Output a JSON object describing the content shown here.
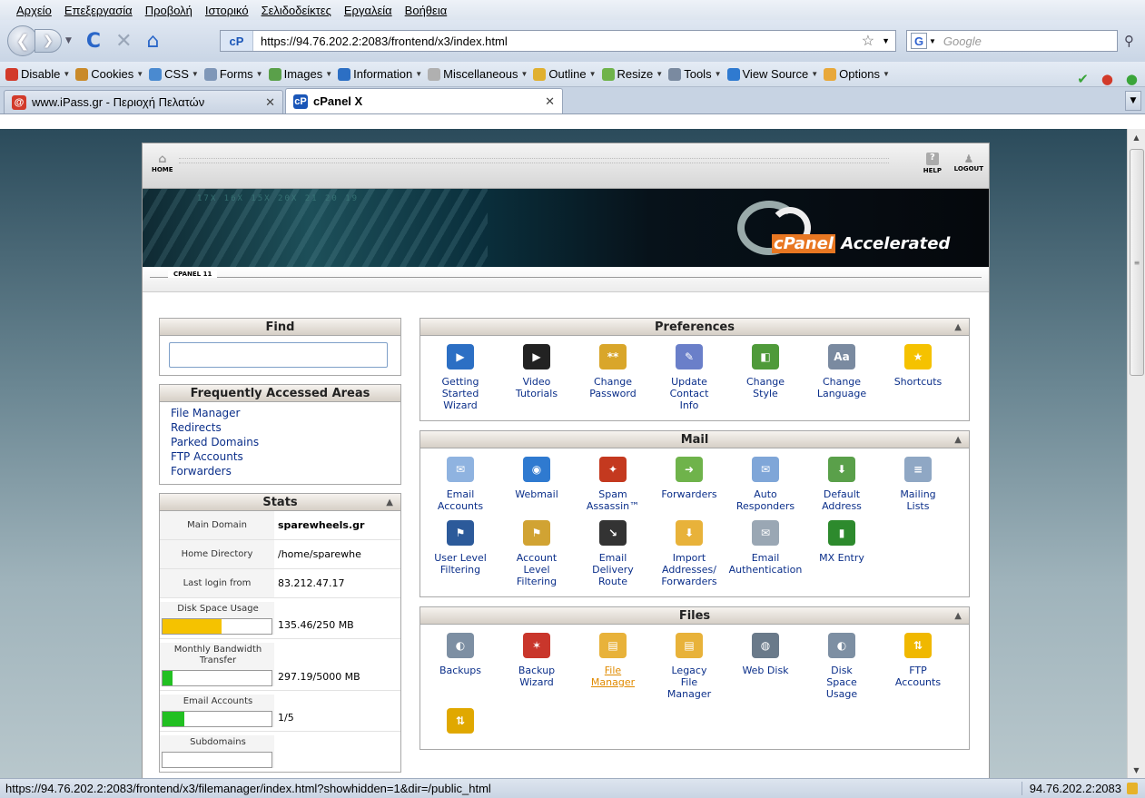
{
  "menubar": {
    "items": [
      "Αρχείο",
      "Επεξεργασία",
      "Προβολή",
      "Ιστορικό",
      "Σελιδοδείκτες",
      "Εργαλεία",
      "Βοήθεια"
    ]
  },
  "navbar": {
    "url": "https://94.76.202.2:2083/frontend/x3/index.html",
    "search_placeholder": "Google"
  },
  "toolbar": {
    "items": [
      "Disable",
      "Cookies",
      "CSS",
      "Forms",
      "Images",
      "Information",
      "Miscellaneous",
      "Outline",
      "Resize",
      "Tools",
      "View Source",
      "Options"
    ]
  },
  "tabs": [
    {
      "label": "www.iPass.gr - Περιοχή Πελατών",
      "active": false
    },
    {
      "label": "cPanel X",
      "active": true
    }
  ],
  "cpanel": {
    "home_label": "HOME",
    "help_label": "HELP",
    "logout_label": "LOGOUT",
    "banner_brand_a": "cPanel",
    "banner_brand_b": "Accelerated",
    "banner_digits": "17X  16X  15X  20X  21  20  19",
    "version_label": "CPANEL 11"
  },
  "sidebar": {
    "find_title": "Find",
    "faa_title": "Frequently Accessed Areas",
    "faa_links": [
      "File Manager",
      "Redirects",
      "Parked Domains",
      "FTP Accounts",
      "Forwarders"
    ],
    "stats_title": "Stats",
    "stats": [
      {
        "label": "Main Domain",
        "value": "sparewheels.gr"
      },
      {
        "label": "Home Directory",
        "value": "/home/sparewhe"
      },
      {
        "label": "Last login from",
        "value": "83.212.47.17"
      }
    ],
    "bars": [
      {
        "label": "Disk Space Usage",
        "value": "135.46/250 MB",
        "fraction": 0.54,
        "color": "#f5c200"
      },
      {
        "label": "Monthly Bandwidth Transfer",
        "value": "297.19/5000 MB",
        "fraction": 0.09,
        "color": "#22c022"
      },
      {
        "label": "Email Accounts",
        "value": "1/5",
        "fraction": 0.2,
        "color": "#22c022"
      },
      {
        "label": "Subdomains",
        "value": "",
        "fraction": 0,
        "color": "#22c022"
      }
    ]
  },
  "panels": [
    {
      "title": "Preferences",
      "items": [
        {
          "label": "Getting\nStarted\nWizard",
          "icon": "play-icon",
          "color": "#2c6fc4",
          "glyph": "▶"
        },
        {
          "label": "Video\nTutorials",
          "icon": "video-icon",
          "color": "#222",
          "glyph": "▶"
        },
        {
          "label": "Change\nPassword",
          "icon": "password-icon",
          "color": "#d9a62a",
          "glyph": "**"
        },
        {
          "label": "Update\nContact\nInfo",
          "icon": "contact-icon",
          "color": "#6a7fc9",
          "glyph": "✎"
        },
        {
          "label": "Change\nStyle",
          "icon": "style-icon",
          "color": "#4f9a3a",
          "glyph": "◧"
        },
        {
          "label": "Change\nLanguage",
          "icon": "language-icon",
          "color": "#7a8aa0",
          "glyph": "Aa"
        },
        {
          "label": "Shortcuts",
          "icon": "star-icon",
          "color": "#f5c200",
          "glyph": "★"
        }
      ]
    },
    {
      "title": "Mail",
      "items": [
        {
          "label": "Email\nAccounts",
          "icon": "envelope-icon",
          "color": "#8fb3e0",
          "glyph": "✉"
        },
        {
          "label": "Webmail",
          "icon": "globe-icon",
          "color": "#2f7ad0",
          "glyph": "◉"
        },
        {
          "label": "Spam\nAssassin™",
          "icon": "spam-icon",
          "color": "#c4391f",
          "glyph": "✦"
        },
        {
          "label": "Forwarders",
          "icon": "forward-icon",
          "color": "#6fb34b",
          "glyph": "➜"
        },
        {
          "label": "Auto\nResponders",
          "icon": "autorespond-icon",
          "color": "#7fa6d8",
          "glyph": "✉"
        },
        {
          "label": "Default\nAddress",
          "icon": "default-address-icon",
          "color": "#5aa04a",
          "glyph": "⬇"
        },
        {
          "label": "Mailing\nLists",
          "icon": "mailing-list-icon",
          "color": "#8fa7c4",
          "glyph": "≡"
        },
        {
          "label": "User Level\nFiltering",
          "icon": "user-filter-icon",
          "color": "#2c5a9a",
          "glyph": "⚑"
        },
        {
          "label": "Account\nLevel\nFiltering",
          "icon": "account-filter-icon",
          "color": "#d1a333",
          "glyph": "⚑"
        },
        {
          "label": "Email\nDelivery\nRoute",
          "icon": "delivery-icon",
          "color": "#333",
          "glyph": "↘"
        },
        {
          "label": "Import\nAddresses/\nForwarders",
          "icon": "import-icon",
          "color": "#e8b23a",
          "glyph": "⬇"
        },
        {
          "label": "Email\nAuthentication",
          "icon": "authentication-icon",
          "color": "#9aa7b4",
          "glyph": "✉"
        },
        {
          "label": "MX Entry",
          "icon": "mx-icon",
          "color": "#2d8a2d",
          "glyph": "▮"
        }
      ]
    },
    {
      "title": "Files",
      "items": [
        {
          "label": "Backups",
          "icon": "backup-icon",
          "color": "#7d8fa3",
          "glyph": "◐"
        },
        {
          "label": "Backup\nWizard",
          "icon": "backup-wizard-icon",
          "color": "#c9362b",
          "glyph": "✶"
        },
        {
          "label": "File\nManager",
          "icon": "folder-icon",
          "color": "#e8b23a",
          "glyph": "▤",
          "highlight": true
        },
        {
          "label": "Legacy\nFile\nManager",
          "icon": "legacy-folder-icon",
          "color": "#e8b23a",
          "glyph": "▤"
        },
        {
          "label": "Web Disk",
          "icon": "web-disk-icon",
          "color": "#6a7a8a",
          "glyph": "◍"
        },
        {
          "label": "Disk\nSpace\nUsage",
          "icon": "disk-icon",
          "color": "#7d8fa3",
          "glyph": "◐"
        },
        {
          "label": "FTP\nAccounts",
          "icon": "ftp-icon",
          "color": "#f0b800",
          "glyph": "⇅"
        },
        {
          "label": "",
          "icon": "ftp-session-icon",
          "color": "#e0a800",
          "glyph": "⇅"
        }
      ]
    }
  ],
  "statusbar": {
    "url": "https://94.76.202.2:2083/frontend/x3/filemanager/index.html?showhidden=1&dir=/public_html",
    "host": "94.76.202.2:2083"
  }
}
